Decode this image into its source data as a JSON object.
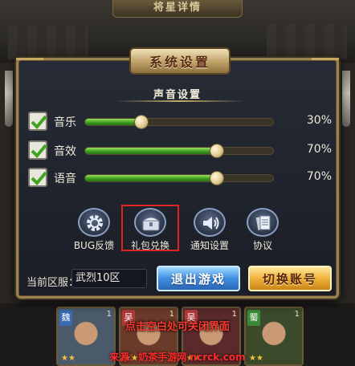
{
  "background": {
    "top_banner": "将星详情",
    "heroes": [
      {
        "tag": "魏",
        "tag_color": "#3a6ab0",
        "count": "1",
        "stars": "★★"
      },
      {
        "tag": "吴",
        "tag_color": "#b03a3a",
        "count": "1",
        "stars": "★★"
      },
      {
        "tag": "吴",
        "tag_color": "#b03a3a",
        "count": "1",
        "stars": "★★"
      },
      {
        "tag": "蜀",
        "tag_color": "#3a8a3a",
        "count": "1",
        "stars": "★★"
      }
    ]
  },
  "dialog": {
    "title": "系统设置",
    "section_title": "声音设置",
    "sliders": [
      {
        "label": "音乐",
        "value_text": "30%",
        "level": 0.3,
        "checked": true
      },
      {
        "label": "音效",
        "value_text": "70%",
        "level": 0.7,
        "checked": true
      },
      {
        "label": "语音",
        "value_text": "70%",
        "level": 0.7,
        "checked": true
      }
    ],
    "buttons": [
      {
        "label": "BUG反馈",
        "icon": "gear-icon"
      },
      {
        "label": "礼包兑换",
        "icon": "gift-chest-icon",
        "highlighted": true
      },
      {
        "label": "通知设置",
        "icon": "speaker-icon"
      },
      {
        "label": "协议",
        "icon": "document-icon"
      }
    ],
    "server_label": "当前区服：",
    "server_value": "武烈10区",
    "exit_button": "退出游戏",
    "switch_button": "切换账号"
  },
  "close_hint": "点击空白处可关闭界面",
  "watermark": "来源：奶茶手游网 ncrck.com",
  "colors": {
    "frame_gold": "#9a8350",
    "slider_green": "#3a9a1e",
    "exit_blue": "#3f8ee0",
    "switch_gold": "#f0b23a",
    "highlight_red": "#e02222"
  }
}
